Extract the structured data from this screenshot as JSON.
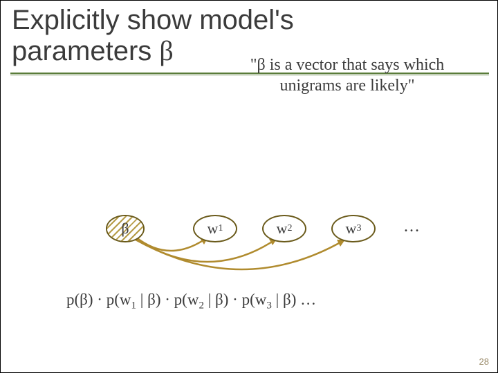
{
  "title_line1": "Explicitly show model's",
  "title_line2_prefix": "parameters ",
  "title_line2_symbol": "β",
  "caption_line1_prefix": "\"",
  "caption_symbol": "β",
  "caption_line1_rest": " is a vector that says which",
  "caption_line2": "unigrams are likely\"",
  "nodes": {
    "beta": "β",
    "w1_label": "w",
    "w1_sub": "1",
    "w2_label": "w",
    "w2_sub": "2",
    "w3_label": "w",
    "w3_sub": "3",
    "ellipsis": "…"
  },
  "formula": {
    "p": "p(",
    "b": "β",
    "close": ")",
    "dot": " · ",
    "pw": "p(w",
    "s1": "1",
    "s2": "2",
    "s3": "3",
    "bar": " | ",
    "trail": " …"
  },
  "page_number": "28",
  "colors": {
    "accent_green": "#5a7c3a",
    "node_border": "#6a5a1a",
    "arc": "#b08b2e"
  },
  "chart_data": {
    "type": "table",
    "description": "Bayesian network: prior on β with sequential word nodes w1, w2, w3 ... each depending on β",
    "nodes": [
      "β",
      "w1",
      "w2",
      "w3",
      "…"
    ],
    "edges": [
      [
        "β",
        "w1"
      ],
      [
        "β",
        "w2"
      ],
      [
        "β",
        "w3"
      ]
    ],
    "joint_factorization": "p(β) · p(w1 | β) · p(w2 | β) · p(w3 | β) …"
  }
}
